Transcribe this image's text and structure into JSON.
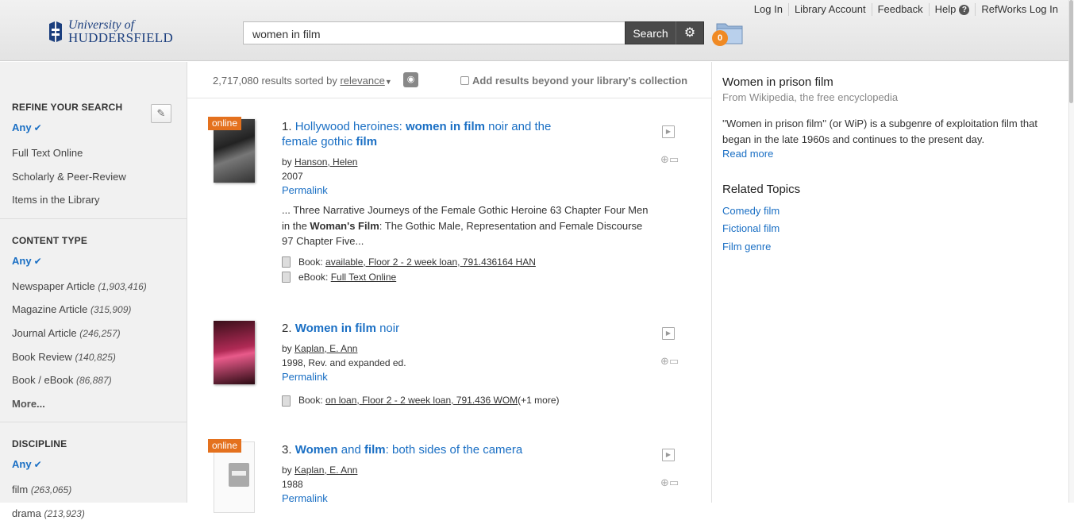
{
  "header": {
    "logo_line1": "University of",
    "logo_line2": "HUDDERSFIELD",
    "search_value": "women in film",
    "search_button": "Search",
    "settings_icon": "gear-icon",
    "folder_count": "0",
    "nav": [
      "Log In",
      "Library Account",
      "Feedback",
      "Help",
      "RefWorks Log In"
    ]
  },
  "sidebar": {
    "refine": {
      "heading": "REFINE YOUR SEARCH",
      "any": "Any",
      "items": [
        "Full Text Online",
        "Scholarly & Peer-Review",
        "Items in the Library"
      ]
    },
    "content_type": {
      "heading": "CONTENT TYPE",
      "any": "Any",
      "items": [
        {
          "label": "Newspaper Article",
          "count": "(1,903,416)"
        },
        {
          "label": "Magazine Article",
          "count": "(315,909)"
        },
        {
          "label": "Journal Article",
          "count": "(246,257)"
        },
        {
          "label": "Book Review",
          "count": "(140,825)"
        },
        {
          "label": "Book / eBook",
          "count": "(86,887)"
        }
      ],
      "more": "More..."
    },
    "discipline": {
      "heading": "DISCIPLINE",
      "any": "Any",
      "items": [
        {
          "label": "film",
          "count": "(263,065)"
        },
        {
          "label": "drama",
          "count": "(213,923)"
        }
      ]
    }
  },
  "results_bar": {
    "count": "2,717,080 results sorted by",
    "sort": "relevance",
    "beyond_label": "Add results beyond your library's collection"
  },
  "results": [
    {
      "online": "online",
      "num": "1.",
      "title_parts": [
        "Hollywood heroines: ",
        "women in film",
        " noir and the female gothic ",
        "film"
      ],
      "author_prefix": "by",
      "author": "Hanson, Helen",
      "year": "2007",
      "permalink": "Permalink",
      "snippet_1": "... Three Narrative Journeys of the Female Gothic Heroine 63 Chapter Four Men in the ",
      "snippet_bold": "Woman's Film",
      "snippet_2": ": The Gothic Male, Representation and Female Discourse 97 Chapter Five...",
      "holdings": [
        {
          "type": "Book:",
          "link": "available, Floor 2 - 2 week loan, 791.436164 HAN",
          "extra": ""
        },
        {
          "type": "eBook:",
          "link": "Full Text Online",
          "extra": ""
        }
      ]
    },
    {
      "num": "2.",
      "title_parts": [
        "Women in film",
        " noir"
      ],
      "author_prefix": "by",
      "author": "Kaplan, E. Ann",
      "year": "1998, Rev. and expanded ed.",
      "permalink": "Permalink",
      "holdings": [
        {
          "type": "Book:",
          "link": "on loan, Floor 2 - 2 week loan, 791.436 WOM",
          "extra": " (+1 more)"
        }
      ]
    },
    {
      "online": "online",
      "num": "3.",
      "title_parts": [
        "Women",
        " and ",
        "film",
        ": both sides of the camera"
      ],
      "author_prefix": "by",
      "author": "Kaplan, E. Ann",
      "year": "1988",
      "permalink": "Permalink"
    }
  ],
  "wiki": {
    "title": "Women in prison film",
    "source": "From Wikipedia, the free encyclopedia",
    "text": "''Women in prison film'' (or WiP) is a subgenre of exploitation film that began in the late 1960s and continues to the present day.",
    "read_more": "Read more",
    "related_heading": "Related Topics",
    "related": [
      "Comedy film",
      "Fictional film",
      "Film genre"
    ]
  }
}
